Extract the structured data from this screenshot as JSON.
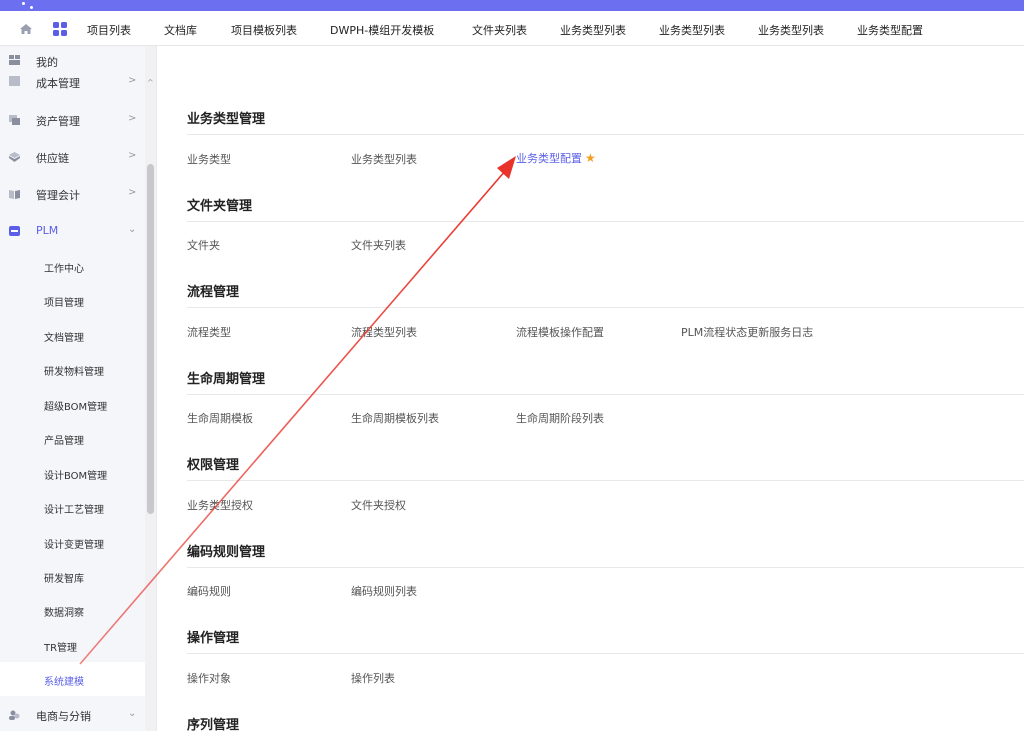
{
  "tabbar": {
    "tabs": [
      "项目列表",
      "文档库",
      "项目模板列表",
      "DWPH-模组开发模板",
      "文件夹列表",
      "业务类型列表",
      "业务类型列表",
      "业务类型列表",
      "业务类型配置"
    ]
  },
  "sidebar": {
    "top_items": [
      {
        "label": "我的",
        "icon": "dashboard-icon"
      },
      {
        "label": "成本管理",
        "icon": "grid-icon"
      },
      {
        "label": "资产管理",
        "icon": "asset-icon"
      },
      {
        "label": "供应链",
        "icon": "cube-icon"
      },
      {
        "label": "管理会计",
        "icon": "book-icon"
      },
      {
        "label": "PLM",
        "icon": "plm-icon"
      }
    ],
    "plm_children": [
      "工作中心",
      "项目管理",
      "文档管理",
      "研发物料管理",
      "超级BOM管理",
      "产品管理",
      "设计BOM管理",
      "设计工艺管理",
      "设计变更管理",
      "研发智库",
      "数据洞察",
      "TR管理",
      "系统建模"
    ],
    "bottom_item": {
      "label": "电商与分销",
      "icon": "people-icon"
    }
  },
  "sections": [
    {
      "title": "业务类型管理",
      "items": [
        "业务类型",
        "业务类型列表",
        "业务类型配置"
      ]
    },
    {
      "title": "文件夹管理",
      "items": [
        "文件夹",
        "文件夹列表"
      ]
    },
    {
      "title": "流程管理",
      "items": [
        "流程类型",
        "流程类型列表",
        "流程模板操作配置",
        "PLM流程状态更新服务日志"
      ]
    },
    {
      "title": "生命周期管理",
      "items": [
        "生命周期模板",
        "生命周期模板列表",
        "生命周期阶段列表"
      ]
    },
    {
      "title": "权限管理",
      "items": [
        "业务类型授权",
        "文件夹授权"
      ]
    },
    {
      "title": "编码规则管理",
      "items": [
        "编码规则",
        "编码规则列表"
      ]
    },
    {
      "title": "操作管理",
      "items": [
        "操作对象",
        "操作列表"
      ]
    },
    {
      "title": "序列管理",
      "items": []
    }
  ],
  "colors": {
    "accent": "#5b5fe8",
    "topbar": "#6b6ff0",
    "star": "#f0a020",
    "arrow": "#e8322a"
  }
}
